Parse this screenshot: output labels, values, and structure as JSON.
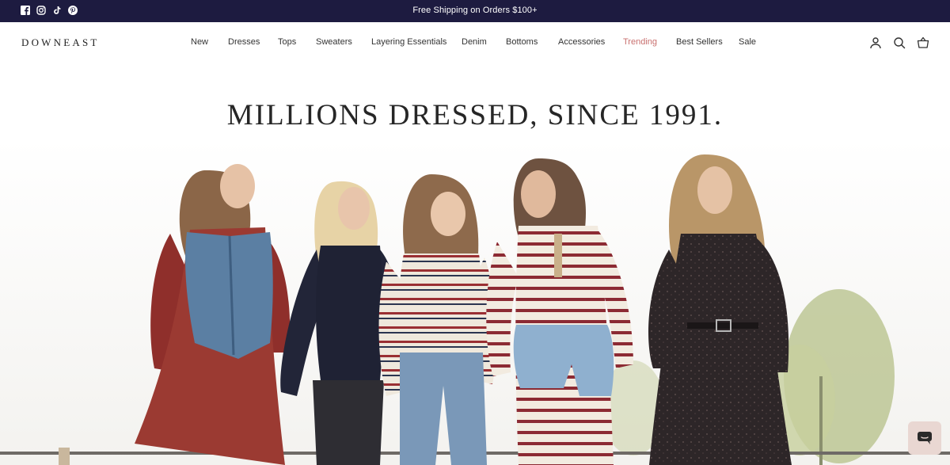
{
  "announcement": {
    "text": "Free Shipping on Orders $100+",
    "social_icons": [
      "facebook-icon",
      "instagram-icon",
      "tiktok-icon",
      "pinterest-icon"
    ],
    "background_color": "#1d1b40"
  },
  "header": {
    "logo": "DOWNEAST",
    "nav": [
      {
        "label": "New"
      },
      {
        "label": "Dresses"
      },
      {
        "label": "Tops"
      },
      {
        "label": "Sweaters"
      },
      {
        "label": "Layering Essentials"
      },
      {
        "label": "Denim"
      },
      {
        "label": "Bottoms"
      },
      {
        "label": "Accessories"
      },
      {
        "label": "Trending",
        "highlight_color": "#c9706f"
      },
      {
        "label": "Best Sellers"
      },
      {
        "label": "Sale"
      }
    ],
    "icons": [
      "account-icon",
      "search-icon",
      "cart-icon"
    ]
  },
  "hero": {
    "title": "MILLIONS DRESSED, SINCE 1991."
  },
  "chat": {
    "icon": "chat-icon",
    "color": "#e9d7d2"
  }
}
